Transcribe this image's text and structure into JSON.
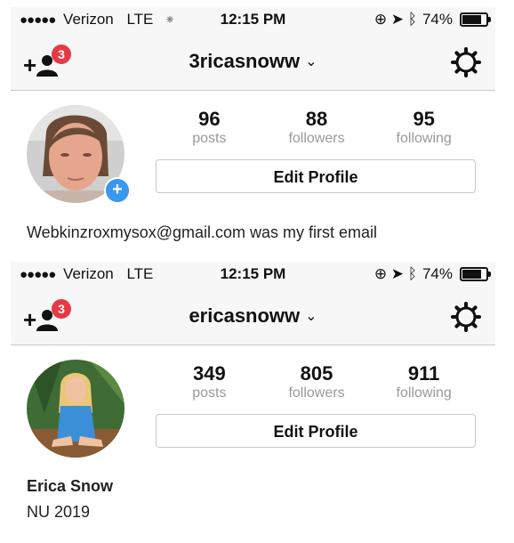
{
  "profiles": [
    {
      "status": {
        "signal": "●●●●●",
        "carrier": "Verizon",
        "network": "LTE",
        "activity": "⁕",
        "time": "12:15 PM",
        "indicators": "⊕ ➤ ᛒ",
        "battery": "74%",
        "battery_level": 0.74
      },
      "nav": {
        "badge": "3",
        "username": "3ricasnoww",
        "chevron": "⌄"
      },
      "stats": {
        "posts": "96",
        "posts_label": "posts",
        "followers": "88",
        "followers_label": "followers",
        "following": "95",
        "following_label": "following"
      },
      "edit_label": "Edit Profile",
      "bio": "Webkinzroxmysox@gmail.com was my first email"
    },
    {
      "status": {
        "signal": "●●●●●",
        "carrier": "Verizon",
        "network": "LTE",
        "time": "12:15 PM",
        "indicators": "⊕ ➤ ᛒ",
        "battery": "74%",
        "battery_level": 0.74
      },
      "nav": {
        "badge": "3",
        "username": "ericasnoww",
        "chevron": "⌄"
      },
      "stats": {
        "posts": "349",
        "posts_label": "posts",
        "followers": "805",
        "followers_label": "followers",
        "following": "911",
        "following_label": "following"
      },
      "edit_label": "Edit Profile",
      "full_name": "Erica Snow",
      "bio": "NU 2019"
    }
  ],
  "icons": {
    "add_people": "add-people-icon",
    "settings": "gear-icon",
    "add_photo": "add-photo-icon"
  },
  "colors": {
    "badge": "#e63946",
    "add_photo": "#3897f0",
    "muted": "#999999"
  }
}
